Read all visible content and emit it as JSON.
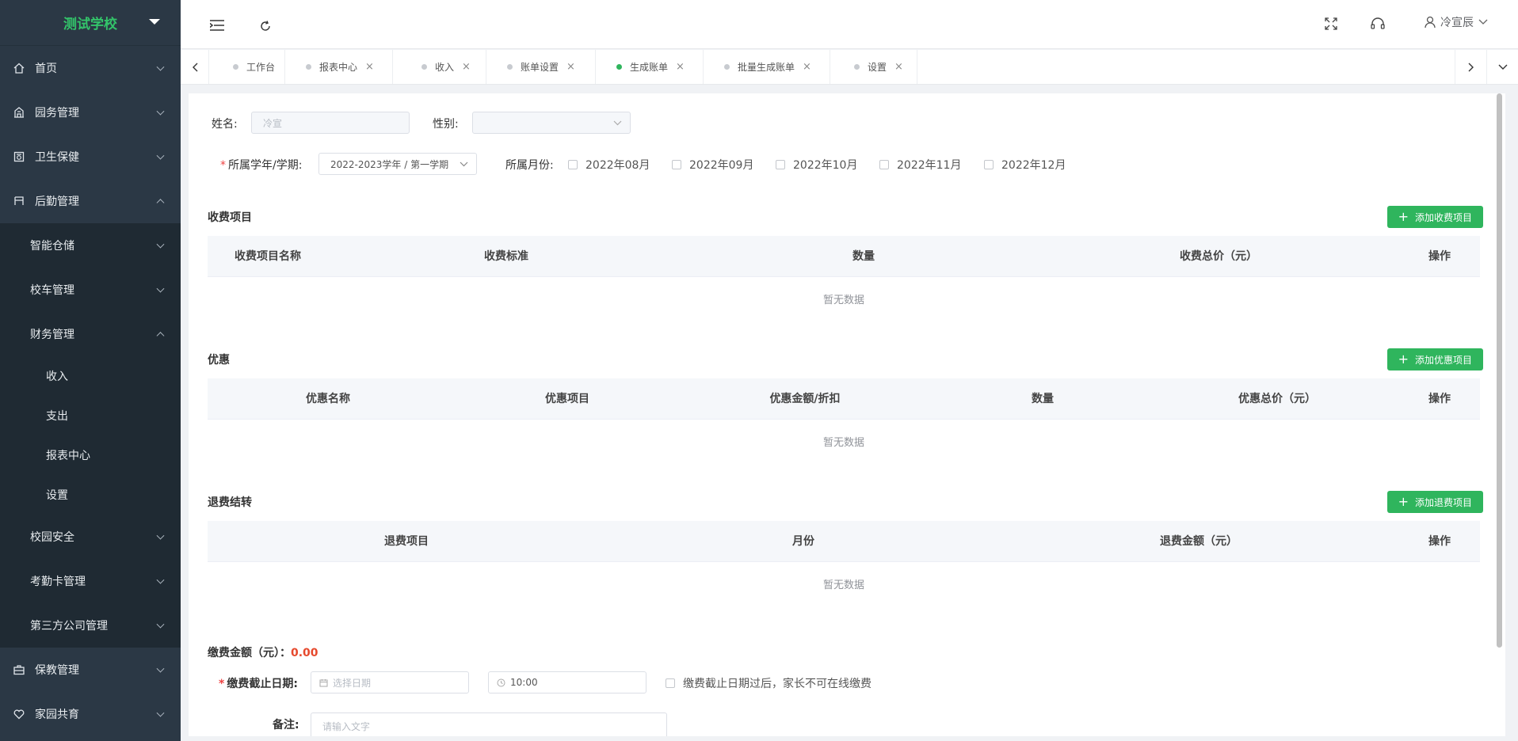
{
  "brand": {
    "title": "测试学校"
  },
  "sidebar": {
    "items": [
      {
        "label": "首页",
        "icon": "home-icon"
      },
      {
        "label": "园务管理",
        "icon": "building-icon"
      },
      {
        "label": "卫生保健",
        "icon": "health-icon"
      },
      {
        "label": "后勤管理",
        "icon": "logistics-icon"
      },
      {
        "label": "智能仓储"
      },
      {
        "label": "校车管理"
      },
      {
        "label": "财务管理"
      },
      {
        "label": "收入"
      },
      {
        "label": "支出"
      },
      {
        "label": "报表中心"
      },
      {
        "label": "设置"
      },
      {
        "label": "校园安全"
      },
      {
        "label": "考勤卡管理"
      },
      {
        "label": "第三方公司管理"
      },
      {
        "label": "保教管理",
        "icon": "briefcase-icon"
      },
      {
        "label": "家园共育",
        "icon": "heart-icon"
      }
    ]
  },
  "header": {
    "user_name": "冷宣辰"
  },
  "tabs": [
    {
      "label": "工作台"
    },
    {
      "label": "报表中心",
      "close": "×"
    },
    {
      "label": "收入",
      "close": "×"
    },
    {
      "label": "账单设置",
      "close": "×"
    },
    {
      "label": "生成账单",
      "close": "×"
    },
    {
      "label": "批量生成账单",
      "close": "×"
    },
    {
      "label": "设置",
      "close": "×"
    }
  ],
  "form": {
    "name_label": "姓名:",
    "name_value": "冷宣",
    "gender_label": "性别:",
    "gender_value": "",
    "term_label": "所属学年/学期:",
    "term_value": "2022-2023学年 / 第一学期",
    "month_label": "所属月份:",
    "months": [
      "2022年08月",
      "2022年09月",
      "2022年10月",
      "2022年11月",
      "2022年12月"
    ]
  },
  "fees": {
    "title": "收费项目",
    "add_label": "添加收费项目",
    "columns": [
      "收费项目名称",
      "收费标准",
      "数量",
      "收费总价（元）",
      "操作"
    ],
    "empty": "暂无数据"
  },
  "discounts": {
    "title": "优惠",
    "add_label": "添加优惠项目",
    "columns": [
      "优惠名称",
      "优惠项目",
      "优惠金额/折扣",
      "数量",
      "优惠总价（元）",
      "操作"
    ],
    "empty": "暂无数据"
  },
  "refunds": {
    "title": "退费结转",
    "add_label": "添加退费项目",
    "columns": [
      "退费项目",
      "月份",
      "退费金额（元）",
      "操作"
    ],
    "empty": "暂无数据"
  },
  "payment": {
    "amount_label": "缴费金额（元）：",
    "amount_value": "0.00",
    "deadline_label": "缴费截止日期:",
    "date_placeholder": "选择日期",
    "time_value": "10:00",
    "deadline_note": "缴费截止日期过后，家长不可在线缴费",
    "remark_label": "备注:",
    "remark_placeholder": "请输入文字"
  },
  "colors": {
    "accent": "#2fb55d",
    "sidebar": "#2b3845",
    "amount": "#e6492d"
  }
}
